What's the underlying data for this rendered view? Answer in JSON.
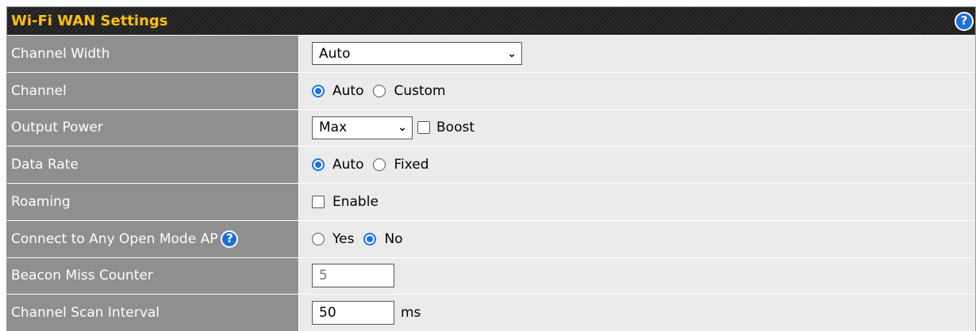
{
  "header": {
    "title": "Wi-Fi WAN Settings",
    "help_icon": "question-circle-icon"
  },
  "rows": {
    "channel_width": {
      "label": "Channel Width",
      "value": "Auto"
    },
    "channel": {
      "label": "Channel",
      "options": [
        "Auto",
        "Custom"
      ],
      "selected": "Auto"
    },
    "output_power": {
      "label": "Output Power",
      "value": "Max",
      "boost_label": "Boost",
      "boost_checked": false
    },
    "data_rate": {
      "label": "Data Rate",
      "options": [
        "Auto",
        "Fixed"
      ],
      "selected": "Auto"
    },
    "roaming": {
      "label": "Roaming",
      "enable_label": "Enable",
      "enabled": false
    },
    "open_mode_ap": {
      "label": "Connect to Any Open Mode AP",
      "options": [
        "Yes",
        "No"
      ],
      "selected": "No"
    },
    "beacon_miss": {
      "label": "Beacon Miss Counter",
      "placeholder": "5"
    },
    "scan_interval": {
      "label": "Channel Scan Interval",
      "value": "50",
      "unit": "ms"
    }
  },
  "colors": {
    "header_text": "#ffc107",
    "label_bg": "#8f8f8f",
    "value_bg": "#ebebeb",
    "accent": "#1a73e8"
  },
  "glyphs": {
    "chevron": "❯",
    "help": "?"
  }
}
